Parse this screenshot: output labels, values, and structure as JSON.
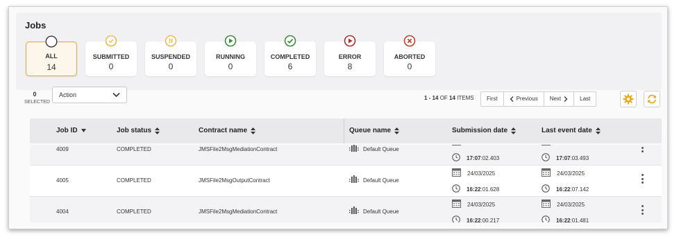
{
  "page": {
    "title": "Jobs"
  },
  "status_cards": [
    {
      "key": "all",
      "label": "ALL",
      "count": "14",
      "color": "#9a9a9a",
      "icon": "circle-icon",
      "active": true
    },
    {
      "key": "submitted",
      "label": "SUBMITTED",
      "count": "0",
      "color": "#e8b84a",
      "icon": "submitted-icon",
      "active": false
    },
    {
      "key": "suspended",
      "label": "SUSPENDED",
      "count": "0",
      "color": "#e8b84a",
      "icon": "pause-icon",
      "active": false
    },
    {
      "key": "running",
      "label": "RUNNING",
      "count": "0",
      "color": "#3a8a3a",
      "icon": "play-icon",
      "active": false
    },
    {
      "key": "completed",
      "label": "COMPLETED",
      "count": "6",
      "color": "#3a8a3a",
      "icon": "check-icon",
      "active": false
    },
    {
      "key": "error",
      "label": "ERROR",
      "count": "8",
      "color": "#b02a2a",
      "icon": "error-play-icon",
      "active": false
    },
    {
      "key": "aborted",
      "label": "ABORTED",
      "count": "0",
      "color": "#c0392b",
      "icon": "x-icon",
      "active": false
    }
  ],
  "toolbar": {
    "selected_count": "0",
    "selected_label": "SELECTED",
    "action_label": "Action",
    "items_range": "1 - 14",
    "items_of": "OF",
    "items_total": "14",
    "items_suffix": "ITEMS",
    "pager": {
      "first": "First",
      "previous": "Previous",
      "next": "Next",
      "last": "Last"
    },
    "accent_color": "#e8a820"
  },
  "table": {
    "columns": {
      "job_id": "Job ID",
      "job_status": "Job status",
      "contract_name": "Contract name",
      "queue_name": "Queue name",
      "submission_date": "Submission date",
      "last_event_date": "Last event date"
    },
    "rows": [
      {
        "job_id": "4009",
        "status": "COMPLETED",
        "contract": "JMSFile2MsgMediationContract",
        "queue": "Default Queue",
        "sub_date": "",
        "sub_time_bold": "17:07",
        "sub_time_rest": ":02.403",
        "last_date": "",
        "last_time_bold": "17:07",
        "last_time_rest": ":03.493"
      },
      {
        "job_id": "4005",
        "status": "COMPLETED",
        "contract": "JMSFile2MsgOutputContract",
        "queue": "Default Queue",
        "sub_date": "24/03/2025",
        "sub_time_bold": "16:22",
        "sub_time_rest": ":01.628",
        "last_date": "24/03/2025",
        "last_time_bold": "16:22",
        "last_time_rest": ":07.142"
      },
      {
        "job_id": "4004",
        "status": "COMPLETED",
        "contract": "JMSFile2MsgMediationContract",
        "queue": "Default Queue",
        "sub_date": "24/03/2025",
        "sub_time_bold": "16:22",
        "sub_time_rest": ":00.217",
        "last_date": "24/03/2025",
        "last_time_bold": "16:22",
        "last_time_rest": ":01.481"
      }
    ]
  }
}
